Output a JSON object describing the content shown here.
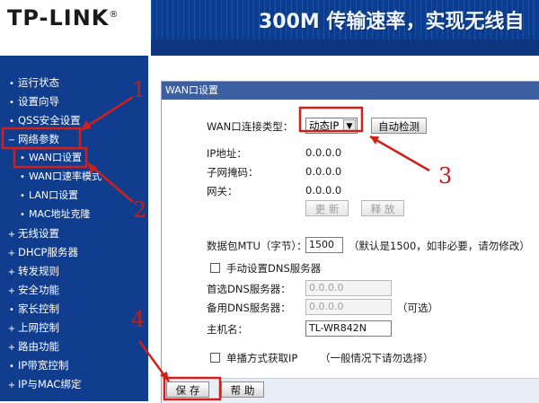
{
  "header": {
    "logo": "TP-LINK",
    "logo_mark": "®",
    "slogan": "300M 传输速率，实现无线自"
  },
  "sidebar": {
    "items": [
      {
        "label": "运行状态",
        "bullet": "•"
      },
      {
        "label": "设置向导",
        "bullet": "•"
      },
      {
        "label": "QSS安全设置",
        "bullet": "•"
      },
      {
        "label": "网络参数",
        "bullet": "−"
      },
      {
        "label": "WAN口设置",
        "bullet": "•"
      },
      {
        "label": "WAN口速率模式",
        "bullet": "•"
      },
      {
        "label": "LAN口设置",
        "bullet": "•"
      },
      {
        "label": "MAC地址克隆",
        "bullet": "•"
      },
      {
        "label": "无线设置",
        "bullet": "+"
      },
      {
        "label": "DHCP服务器",
        "bullet": "+"
      },
      {
        "label": "转发规则",
        "bullet": "+"
      },
      {
        "label": "安全功能",
        "bullet": "+"
      },
      {
        "label": "家长控制",
        "bullet": "•"
      },
      {
        "label": "上网控制",
        "bullet": "+"
      },
      {
        "label": "路由功能",
        "bullet": "+"
      },
      {
        "label": "IP带宽控制",
        "bullet": "•"
      },
      {
        "label": "IP与MAC绑定",
        "bullet": "+"
      }
    ]
  },
  "panel": {
    "title": "WAN口设置",
    "wan_type_label": "WAN口连接类型：",
    "wan_type_value": "动态IP",
    "wan_type_arrow": "▼",
    "auto_detect": "自动检测",
    "ip_label": "IP地址：",
    "ip_value": "0.0.0.0",
    "mask_label": "子网掩码：",
    "mask_value": "0.0.0.0",
    "gateway_label": "网关：",
    "gateway_value": "0.0.0.0",
    "renew": "更 新",
    "release": "释 放",
    "mtu_label": "数据包MTU（字节）：",
    "mtu_value": "1500",
    "mtu_hint": "（默认是1500，如非必要，请勿修改）",
    "dns_manual_label": "手动设置DNS服务器",
    "dns1_label": "首选DNS服务器：",
    "dns1_value": "0.0.0.0",
    "dns2_label": "备用DNS服务器：",
    "dns2_value": "0.0.0.0",
    "optional": "（可选）",
    "hostname_label": "主机名：",
    "hostname_value": "TL-WR842N",
    "unicast_label": "单播方式获取IP",
    "unicast_hint": "（一般情况下请勿选择）",
    "save": "保 存",
    "help": "帮 助"
  },
  "annotations": {
    "n1": "1",
    "n2": "2",
    "n3": "3",
    "n4": "4",
    "color": "#d21f1a"
  }
}
